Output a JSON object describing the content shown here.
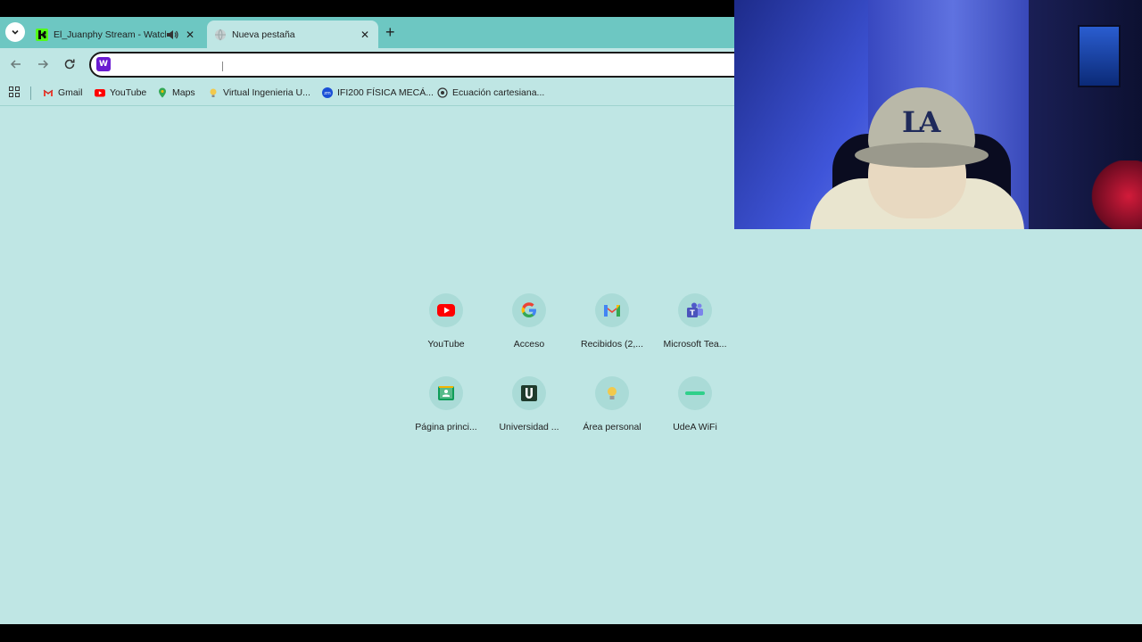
{
  "tabs": [
    {
      "title": "El_Juanphy Stream - Watch",
      "favicon": "kick-icon",
      "audio": true
    },
    {
      "title": "Nueva pestaña",
      "favicon": "globe-icon",
      "active": true
    }
  ],
  "omnibox": {
    "value": "",
    "placeholder": ""
  },
  "bookmarks": [
    {
      "label": "Gmail",
      "icon": "gmail-icon"
    },
    {
      "label": "YouTube",
      "icon": "youtube-icon"
    },
    {
      "label": "Maps",
      "icon": "maps-icon"
    },
    {
      "label": "Virtual Ingenieria U...",
      "icon": "bulb-icon"
    },
    {
      "label": "IFI200 FÍSICA MECÁ...",
      "icon": "zoom-icon"
    },
    {
      "label": "Ecuación cartesiana...",
      "icon": "desmos-icon"
    }
  ],
  "shortcuts": [
    {
      "label": "YouTube",
      "icon": "youtube-icon"
    },
    {
      "label": "Acceso",
      "icon": "google-icon"
    },
    {
      "label": "Recibidos (2,...",
      "icon": "gmail-icon"
    },
    {
      "label": "Microsoft Tea...",
      "icon": "teams-icon"
    },
    {
      "label": "Página princi...",
      "icon": "classroom-icon"
    },
    {
      "label": "Universidad ...",
      "icon": "u-icon"
    },
    {
      "label": "Área personal",
      "icon": "bulb-icon"
    },
    {
      "label": "UdeA WiFi",
      "icon": "wifi-bar-icon"
    }
  ],
  "webcam": {
    "cap_text": "LA"
  },
  "colors": {
    "page_bg": "#bfe6e4",
    "tabstrip": "#6dc7c2",
    "accent": "#6a1bd1"
  }
}
